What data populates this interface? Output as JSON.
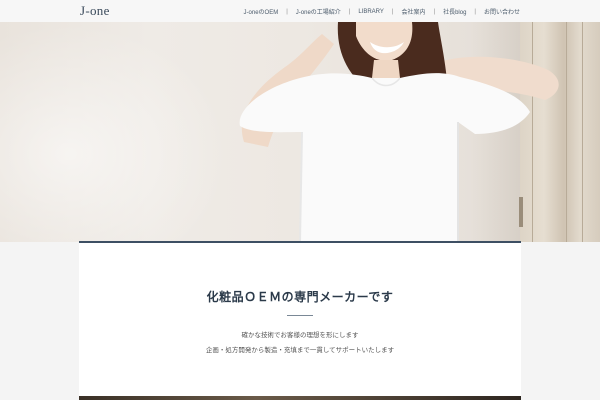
{
  "header": {
    "logo": "J-one",
    "nav": [
      "J-oneのOEM",
      "J-oneの工場紹介",
      "LIBRARY",
      "会社案内",
      "社長blog",
      "お問い合わせ"
    ]
  },
  "hero": {
    "image": "woman-in-white-tshirt-smiling"
  },
  "section": {
    "title": "化粧品ＯＥＭの専門メーカーです",
    "lines": [
      "確かな技術でお客様の理想を形にします",
      "企画・処方開発から製造・充填まで一貫してサポートいたします"
    ]
  },
  "colors": {
    "accent": "#3d4f63",
    "header_bg": "#f7f7f7",
    "panel_bg": "#ffffff",
    "page_bg": "#f4f4f4"
  }
}
